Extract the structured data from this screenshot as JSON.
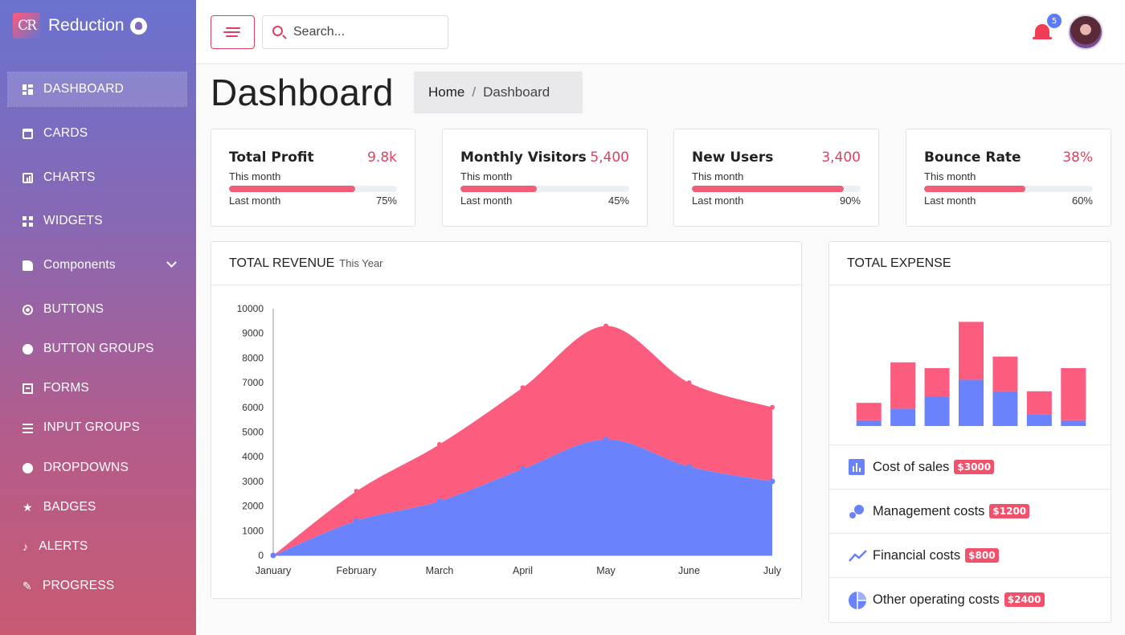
{
  "brand": {
    "logo_text": "CR",
    "name": "Reduction",
    "github_icon": "github-icon"
  },
  "sidebar": {
    "items": [
      {
        "label": "DASHBOARD",
        "icon": "dashboard-icon",
        "active": true
      },
      {
        "label": "CARDS",
        "icon": "card-icon"
      },
      {
        "label": "CHARTS",
        "icon": "chart-icon"
      },
      {
        "label": "WIDGETS",
        "icon": "widgets-icon"
      },
      {
        "label": "Components",
        "icon": "puzzle-icon",
        "expandable": true
      },
      {
        "label": "BUTTONS",
        "icon": "radio-button-icon"
      },
      {
        "label": "BUTTON GROUPS",
        "icon": "button-groups-icon"
      },
      {
        "label": "FORMS",
        "icon": "form-icon"
      },
      {
        "label": "INPUT GROUPS",
        "icon": "list-icon"
      },
      {
        "label": "DROPDOWNS",
        "icon": "dropdown-icon"
      },
      {
        "label": "BADGES",
        "icon": "star-icon"
      },
      {
        "label": "ALERTS",
        "icon": "bell-icon"
      },
      {
        "label": "PROGRESS",
        "icon": "brush-icon"
      }
    ]
  },
  "topbar": {
    "search_placeholder": "Search...",
    "notification_count": "5"
  },
  "page": {
    "title": "Dashboard",
    "breadcrumb": [
      "Home",
      "Dashboard"
    ]
  },
  "stats": [
    {
      "title": "Total Profit",
      "value": "9.8k",
      "sub": "This month",
      "last": "Last month",
      "pct_label": "75%",
      "progress": 0.75
    },
    {
      "title": "Monthly Visitors",
      "value": "5,400",
      "sub": "This month",
      "last": "Last month",
      "pct_label": "45%",
      "progress": 0.45
    },
    {
      "title": "New Users",
      "value": "3,400",
      "sub": "This month",
      "last": "Last month",
      "pct_label": "90%",
      "progress": 0.9
    },
    {
      "title": "Bounce Rate",
      "value": "38%",
      "sub": "This month",
      "last": "Last month",
      "pct_label": "60%",
      "progress": 0.6
    }
  ],
  "revenue": {
    "title": "TOTAL REVENUE",
    "subtitle": "This Year"
  },
  "expense": {
    "title": "TOTAL EXPENSE",
    "items": [
      {
        "label": "Cost of sales",
        "amount": "$3000",
        "icon": "bar-chart-icon"
      },
      {
        "label": "Management costs",
        "amount": "$1200",
        "icon": "bubbles-icon"
      },
      {
        "label": "Financial costs",
        "amount": "$800",
        "icon": "trend-line-icon"
      },
      {
        "label": "Other operating costs",
        "amount": "$2400",
        "icon": "pie-chart-icon"
      }
    ]
  },
  "colors": {
    "accent": "#f25d77",
    "blue": "#6a82fb",
    "red": "#fc5c7d"
  },
  "chart_data": [
    {
      "type": "area",
      "categories": [
        "January",
        "February",
        "March",
        "April",
        "May",
        "June",
        "July"
      ],
      "ylim": [
        0,
        10000
      ],
      "yticks": [
        0,
        1000,
        2000,
        3000,
        4000,
        5000,
        6000,
        7000,
        8000,
        9000,
        10000
      ],
      "stacked": true,
      "series": [
        {
          "color": "#6a82fb",
          "values": [
            0,
            1400,
            2200,
            3500,
            4700,
            3600,
            3000
          ]
        },
        {
          "color": "#fc5c7d",
          "values": [
            0,
            1200,
            2300,
            3300,
            4600,
            3400,
            3000
          ]
        }
      ]
    },
    {
      "type": "bar",
      "stacked": true,
      "ylim": [
        0,
        100
      ],
      "series": [
        {
          "color": "#6a82fb",
          "values": [
            5,
            15,
            25,
            40,
            30,
            10,
            5
          ]
        },
        {
          "color": "#fc5c7d",
          "values": [
            15,
            40,
            25,
            50,
            30,
            20,
            45
          ]
        }
      ]
    }
  ]
}
